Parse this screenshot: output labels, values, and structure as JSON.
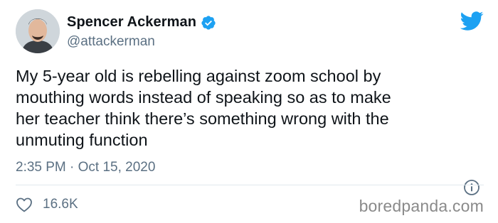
{
  "tweet": {
    "author_name": "Spencer Ackerman",
    "handle": "@attackerman",
    "text_lines": [
      "My 5-year old is rebelling against zoom school by",
      "mouthing words instead of speaking so as to make",
      "her teacher think there’s something wrong with the",
      "unmuting function"
    ],
    "timestamp": "2:35 PM · Oct 15, 2020",
    "like_count": "16.6K"
  },
  "watermark": "boredpanda.com",
  "icons": {
    "verified": "verified-badge-icon",
    "brand": "twitter-bird-icon",
    "info": "info-icon",
    "like": "heart-icon"
  },
  "colors": {
    "brand_blue": "#1da1f2",
    "text_primary": "#0f1419",
    "text_secondary": "#5b7083",
    "divider": "#e1e8ed"
  }
}
